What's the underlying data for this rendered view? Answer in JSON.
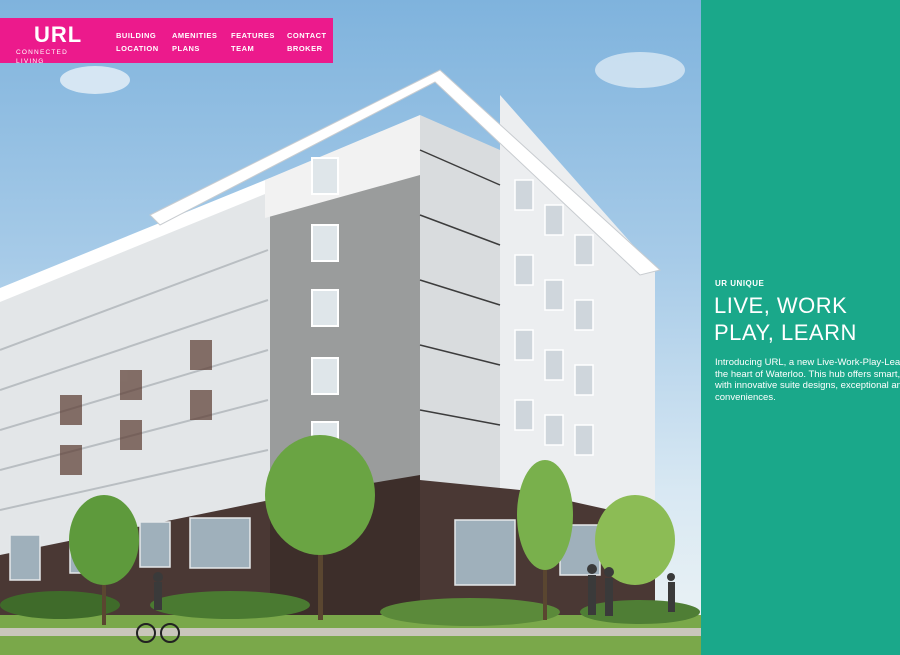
{
  "logo": {
    "name": "URL",
    "tagline": "CONNECTED LIVING"
  },
  "nav": {
    "columns": [
      [
        "BUILDING",
        "LOCATION"
      ],
      [
        "AMENITIES",
        "PLANS"
      ],
      [
        "FEATURES",
        "TEAM"
      ],
      [
        "CONTACT",
        "BROKER"
      ]
    ]
  },
  "panel": {
    "eyebrow": "UR UNIQUE",
    "heading_line1": "LIVE, WORK",
    "heading_line2": "PLAY, LEARN",
    "intro_lines": [
      "Introducing URL, a new Live-Work-Play-Lear",
      "the heart of Waterloo. This hub offers smart, e",
      "with innovative suite designs, exceptional am",
      "conveniences."
    ]
  },
  "colors": {
    "brand_pink": "#ec1a8c",
    "panel_teal": "#1aa88a"
  }
}
